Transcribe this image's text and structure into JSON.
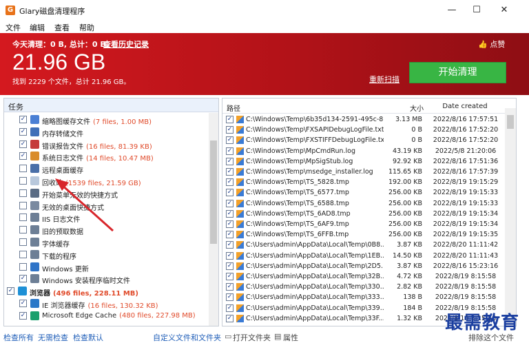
{
  "window": {
    "title": "Glary磁盘清理程序",
    "icon": "app-icon"
  },
  "menu": [
    "文件",
    "编辑",
    "查看",
    "帮助"
  ],
  "banner": {
    "today_clean": "今天清理：0 B, 总计：0 B,",
    "history_link": "查看历史记录",
    "like": "点赞",
    "total_size": "21.96 GB",
    "found_text": "找到 2229 个文件，总计 21.96 GB。",
    "rescan": "重新扫描",
    "start_button": "开始清理"
  },
  "tasks": {
    "header": "任务",
    "items": [
      {
        "label": "缩略图缓存文件",
        "stat": "(7 files, 1.00 MB)",
        "checked": true,
        "indent": 1,
        "icon": "thumbnail-icon",
        "color": "#4a7fd4"
      },
      {
        "label": "内存转储文件",
        "stat": "",
        "checked": true,
        "indent": 1,
        "icon": "memory-dump-icon",
        "color": "#3f6fb8"
      },
      {
        "label": "错误报告文件",
        "stat": "(16 files, 81.39 KB)",
        "checked": true,
        "indent": 1,
        "icon": "error-report-icon",
        "color": "#c53b3b"
      },
      {
        "label": "系统日志文件",
        "stat": "(14 files, 10.47 MB)",
        "checked": true,
        "indent": 1,
        "icon": "system-log-icon",
        "color": "#d98c2b"
      },
      {
        "label": "远程桌面缓存",
        "stat": "",
        "checked": false,
        "indent": 1,
        "icon": "remote-desktop-icon",
        "color": "#4a6fa8"
      },
      {
        "label": "回收站",
        "stat": "(1539 files, 21.59 GB)",
        "checked": false,
        "indent": 1,
        "icon": "recycle-bin-icon",
        "color": "#b8c8dc"
      },
      {
        "label": "开始菜单无效的快捷方式",
        "stat": "",
        "checked": false,
        "indent": 1,
        "icon": "start-menu-icon",
        "color": "#5a6c84"
      },
      {
        "label": "无效的桌面快捷方式",
        "stat": "",
        "checked": false,
        "indent": 1,
        "icon": "desktop-shortcut-icon",
        "color": "#7a8aa0"
      },
      {
        "label": "IIS 日志文件",
        "stat": "",
        "checked": false,
        "indent": 1,
        "icon": "iis-log-icon",
        "color": "#6d7f96"
      },
      {
        "label": "旧的预取数据",
        "stat": "",
        "checked": false,
        "indent": 1,
        "icon": "prefetch-icon",
        "color": "#6d7f96"
      },
      {
        "label": "字体缓存",
        "stat": "",
        "checked": false,
        "indent": 1,
        "icon": "font-cache-icon",
        "color": "#6d7f96"
      },
      {
        "label": "下载的程序",
        "stat": "",
        "checked": false,
        "indent": 1,
        "icon": "downloaded-programs-icon",
        "color": "#6d7f96"
      },
      {
        "label": "Windows 更新",
        "stat": "",
        "checked": false,
        "indent": 1,
        "icon": "windows-update-icon",
        "color": "#2f74c8"
      },
      {
        "label": "Windows 安装程序临时文件",
        "stat": "",
        "checked": true,
        "indent": 1,
        "icon": "installer-temp-icon",
        "color": "#6d7f96"
      },
      {
        "label": "浏览器",
        "stat": "(496 files, 228.11 MB)",
        "checked": true,
        "indent": 0,
        "icon": "browser-icon",
        "color": "#1e90d6",
        "bold": true
      },
      {
        "label": "IE 浏览器缓存",
        "stat": "(16 files, 130.32 KB)",
        "checked": true,
        "indent": 1,
        "icon": "ie-icon",
        "color": "#2a78c8"
      },
      {
        "label": "Microsoft Edge Cache",
        "stat": "(480 files, 227.98 MB)",
        "checked": true,
        "indent": 1,
        "icon": "edge-icon",
        "color": "#1aa06d"
      }
    ]
  },
  "files": {
    "headers": {
      "path": "路径",
      "size": "大小",
      "date": "Date created"
    },
    "rows": [
      {
        "path": "C:\\Windows\\Temp\\6b35d134-2591-495c-8...",
        "size": "3.13 MB",
        "date": "2022/8/16 17:57:51"
      },
      {
        "path": "C:\\Windows\\Temp\\FXSAPIDebugLogFile.txt",
        "size": "0 B",
        "date": "2022/8/16 17:52:20"
      },
      {
        "path": "C:\\Windows\\Temp\\FXSTIFFDebugLogFile.txt",
        "size": "0 B",
        "date": "2022/8/16 17:52:20"
      },
      {
        "path": "C:\\Windows\\Temp\\MpCmdRun.log",
        "size": "43.19 KB",
        "date": "2022/5/8 21:20:06"
      },
      {
        "path": "C:\\Windows\\Temp\\MpSigStub.log",
        "size": "92.92 KB",
        "date": "2022/8/16 17:51:36"
      },
      {
        "path": "C:\\Windows\\Temp\\msedge_installer.log",
        "size": "115.65 KB",
        "date": "2022/8/16 17:57:39"
      },
      {
        "path": "C:\\Windows\\Temp\\TS_5828.tmp",
        "size": "192.00 KB",
        "date": "2022/8/19 19:15:29"
      },
      {
        "path": "C:\\Windows\\Temp\\TS_6577.tmp",
        "size": "256.00 KB",
        "date": "2022/8/19 19:15:33"
      },
      {
        "path": "C:\\Windows\\Temp\\TS_6588.tmp",
        "size": "256.00 KB",
        "date": "2022/8/19 19:15:33"
      },
      {
        "path": "C:\\Windows\\Temp\\TS_6AD8.tmp",
        "size": "256.00 KB",
        "date": "2022/8/19 19:15:34"
      },
      {
        "path": "C:\\Windows\\Temp\\TS_6AF9.tmp",
        "size": "256.00 KB",
        "date": "2022/8/19 19:15:34"
      },
      {
        "path": "C:\\Windows\\Temp\\TS_6FFB.tmp",
        "size": "256.00 KB",
        "date": "2022/8/19 19:15:35"
      },
      {
        "path": "C:\\Users\\admin\\AppData\\Local\\Temp\\0B8...",
        "size": "3.87 KB",
        "date": "2022/8/20 11:11:42"
      },
      {
        "path": "C:\\Users\\admin\\AppData\\Local\\Temp\\1EB...",
        "size": "14.50 KB",
        "date": "2022/8/20 11:11:43"
      },
      {
        "path": "C:\\Users\\admin\\AppData\\Local\\Temp\\2D5...",
        "size": "3.87 KB",
        "date": "2022/8/16 15:23:16"
      },
      {
        "path": "C:\\Users\\admin\\AppData\\Local\\Temp\\32B...",
        "size": "4.72 KB",
        "date": "2022/8/19 8:15:58"
      },
      {
        "path": "C:\\Users\\admin\\AppData\\Local\\Temp\\330...",
        "size": "2.82 KB",
        "date": "2022/8/19 8:15:58"
      },
      {
        "path": "C:\\Users\\admin\\AppData\\Local\\Temp\\333...",
        "size": "138 B",
        "date": "2022/8/19 8:15:58"
      },
      {
        "path": "C:\\Users\\admin\\AppData\\Local\\Temp\\339...",
        "size": "184 B",
        "date": "2022/8/19 8:15:58"
      },
      {
        "path": "C:\\Users\\admin\\AppData\\Local\\Temp\\33F...",
        "size": "1.32 KB",
        "date": "2022/8/19 8:15:58"
      }
    ]
  },
  "bottom": {
    "check_all": "检查所有",
    "check_none": "无需检查",
    "check_default": "检查默认",
    "custom_files": "自定义文件和文件夹",
    "open_folder": "打开文件夹",
    "properties": "属性",
    "exclude": "排除这个文件"
  },
  "watermark": "最需教育",
  "colors": {
    "banner_red": "#c41a20",
    "start_green": "#38b544",
    "stat_red": "#e04a2a",
    "link_blue": "#1f5eb8"
  }
}
